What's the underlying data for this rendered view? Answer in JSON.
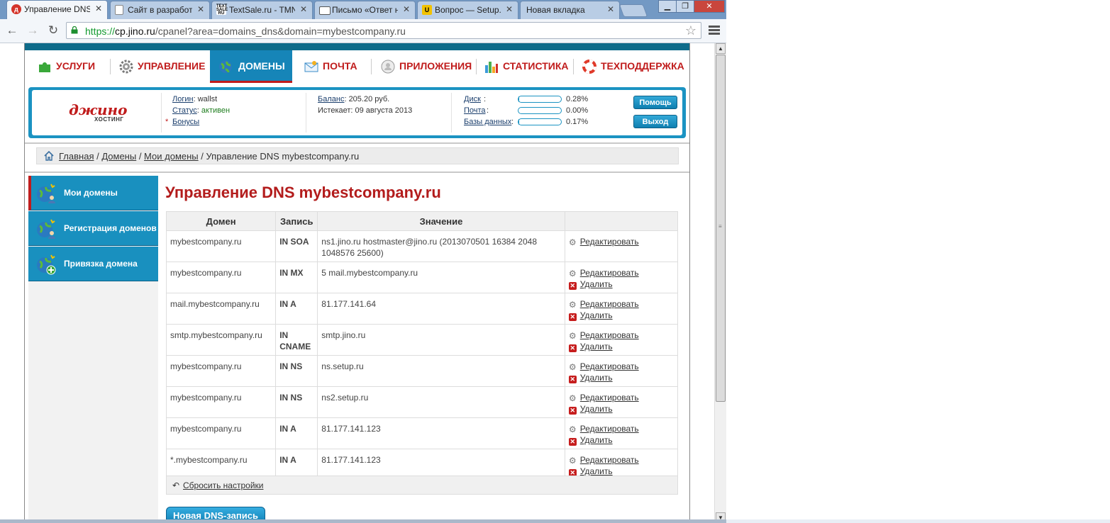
{
  "browser": {
    "tabs": [
      {
        "title": "Управление DNS п",
        "favicon": "jino-icon",
        "active": true
      },
      {
        "title": "Сайт в разработк",
        "favicon": "page-icon",
        "active": false
      },
      {
        "title": "TextSale.ru - TMN",
        "favicon": "textsale-icon",
        "active": false
      },
      {
        "title": "Письмо «Ответ на",
        "favicon": "mail-icon",
        "active": false
      },
      {
        "title": "Вопрос — Setup.r",
        "favicon": "setup-icon",
        "active": false
      },
      {
        "title": "Новая вкладка",
        "favicon": "none",
        "active": false
      }
    ],
    "url": {
      "protocol": "https://",
      "host": "cp.jino.ru",
      "path": "/cpanel?area=domains_dns&domain=mybestcompany.ru"
    },
    "window_buttons": {
      "minimize": "▁",
      "maximize": "❐",
      "close": "✕"
    }
  },
  "nav": {
    "items": [
      {
        "label": "УСЛУГИ",
        "icon": "puzzle-icon"
      },
      {
        "label": "УПРАВЛЕНИЕ",
        "icon": "gear-icon"
      },
      {
        "label": "ДОМЕНЫ",
        "icon": "globe-icon",
        "active": true
      },
      {
        "label": "ПОЧТА",
        "icon": "envelope-icon"
      },
      {
        "label": "ПРИЛОЖЕНИЯ",
        "icon": "apps-icon"
      },
      {
        "label": "СТАТИСТИКА",
        "icon": "bar-chart-icon"
      },
      {
        "label": "ТЕХПОДДЕРЖКА",
        "icon": "lifebuoy-icon"
      }
    ]
  },
  "account": {
    "logo_text": "джино",
    "logo_sub": "ХОСТИНГ",
    "login_label": "Логин",
    "login_value": ": wallst",
    "status_label": "Статус",
    "status_sep": ": ",
    "status_value": "активен",
    "bonus_star": "*",
    "bonus_label": "Бонусы",
    "balance_label": "Баланс",
    "balance_value": ": 205.20 руб.",
    "expires_text": "Истекает: 09 августа 2013",
    "usage": [
      {
        "label": "Диск",
        "value": "0.28%",
        "fraction": 0.0028
      },
      {
        "label": "Почта",
        "value": "0.00%",
        "fraction": 0.0
      },
      {
        "label": "Базы данных",
        "value": "0.17%",
        "fraction": 0.0017
      }
    ],
    "help_button": "Помощь",
    "logout_button": "Выход"
  },
  "breadcrumb": {
    "items": [
      "Главная",
      "Домены",
      "Мои домены"
    ],
    "separator": " / ",
    "current": "Управление DNS mybestcompany.ru"
  },
  "sidebar": {
    "items": [
      {
        "label": "Мои домены",
        "active": true
      },
      {
        "label": "Регистрация доменов",
        "active": false
      },
      {
        "label": "Привязка домена",
        "active": false
      }
    ]
  },
  "main": {
    "title": "Управление DNS mybestcompany.ru",
    "table": {
      "headers": [
        "Домен",
        "Запись",
        "Значение",
        ""
      ],
      "rows": [
        {
          "domain": "mybestcompany.ru",
          "record": "IN SOA",
          "value": "ns1.jino.ru hostmaster@jino.ru (2013070501 16384 2048 1048576 25600)",
          "deletable": false
        },
        {
          "domain": "mybestcompany.ru",
          "record": "IN MX",
          "value": "5 mail.mybestcompany.ru",
          "deletable": true
        },
        {
          "domain": "mail.mybestcompany.ru",
          "record": "IN A",
          "value": "81.177.141.64",
          "deletable": true
        },
        {
          "domain": "smtp.mybestcompany.ru",
          "record": "IN CNAME",
          "value": "smtp.jino.ru",
          "deletable": true
        },
        {
          "domain": "mybestcompany.ru",
          "record": "IN NS",
          "value": "ns.setup.ru",
          "deletable": true
        },
        {
          "domain": "mybestcompany.ru",
          "record": "IN NS",
          "value": "ns2.setup.ru",
          "deletable": true
        },
        {
          "domain": "mybestcompany.ru",
          "record": "IN A",
          "value": "81.177.141.123",
          "deletable": true
        },
        {
          "domain": "*.mybestcompany.ru",
          "record": "IN A",
          "value": "81.177.141.123",
          "deletable": true
        }
      ],
      "edit_label": "Редактировать",
      "delete_label": "Удалить"
    },
    "reset_label": "Сбросить настройки",
    "new_record_button": "Новая DNS-запись"
  },
  "colors": {
    "accent_red": "#c01c1c",
    "brand_blue": "#1b93c2",
    "tab_bar": "#7399c4"
  }
}
